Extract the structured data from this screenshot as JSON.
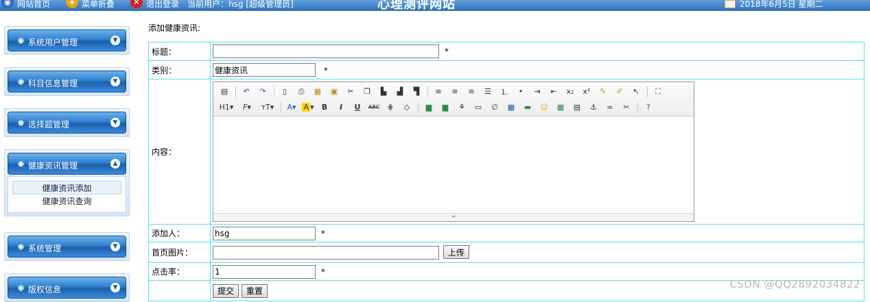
{
  "topbar": {
    "home": "网站首页",
    "collapse": "菜单折叠",
    "logout": "退出登录",
    "current_user": "当前用户：hsg [超级管理员]",
    "site_title": "心理测评网站",
    "date": "2018年6月5日 星期二"
  },
  "sidebar": {
    "menus": [
      {
        "label": "系统用户管理",
        "expanded": false
      },
      {
        "label": "科目信息管理",
        "expanded": false
      },
      {
        "label": "选择题管理",
        "expanded": false
      },
      {
        "label": "健康资讯管理",
        "expanded": true,
        "items": [
          "健康资讯添加",
          "健康资讯查询"
        ],
        "active_item": "健康资讯添加"
      },
      {
        "label": "系统管理",
        "expanded": false
      },
      {
        "label": "版权信息",
        "expanded": false
      }
    ]
  },
  "main": {
    "heading": "添加健康资讯:",
    "fields": {
      "title": {
        "label": "标题：",
        "value": "",
        "required": "*"
      },
      "category": {
        "label": "类别：",
        "value": "健康资讯",
        "required": "*"
      },
      "content": {
        "label": "内容："
      },
      "author": {
        "label": "添加人：",
        "value": "hsg",
        "required": "*"
      },
      "image": {
        "label": "首页图片：",
        "value": "",
        "upload_label": "上传"
      },
      "clicks": {
        "label": "点击率：",
        "value": "1",
        "required": "*"
      }
    },
    "buttons": {
      "submit": "提交",
      "reset": "重置"
    },
    "editor_toolbar": {
      "heading": "H1",
      "font": "F",
      "size": "тT",
      "font_color": "A",
      "highlight": "A",
      "bold": "B",
      "italic": "I",
      "underline": "U",
      "strike": "ABC",
      "sub": "x₂",
      "sup": "x²"
    }
  },
  "watermark": "CSDN @QQ2892034822",
  "colors": {
    "accent": "#2f6fb9",
    "table_border": "#50e0e6"
  }
}
